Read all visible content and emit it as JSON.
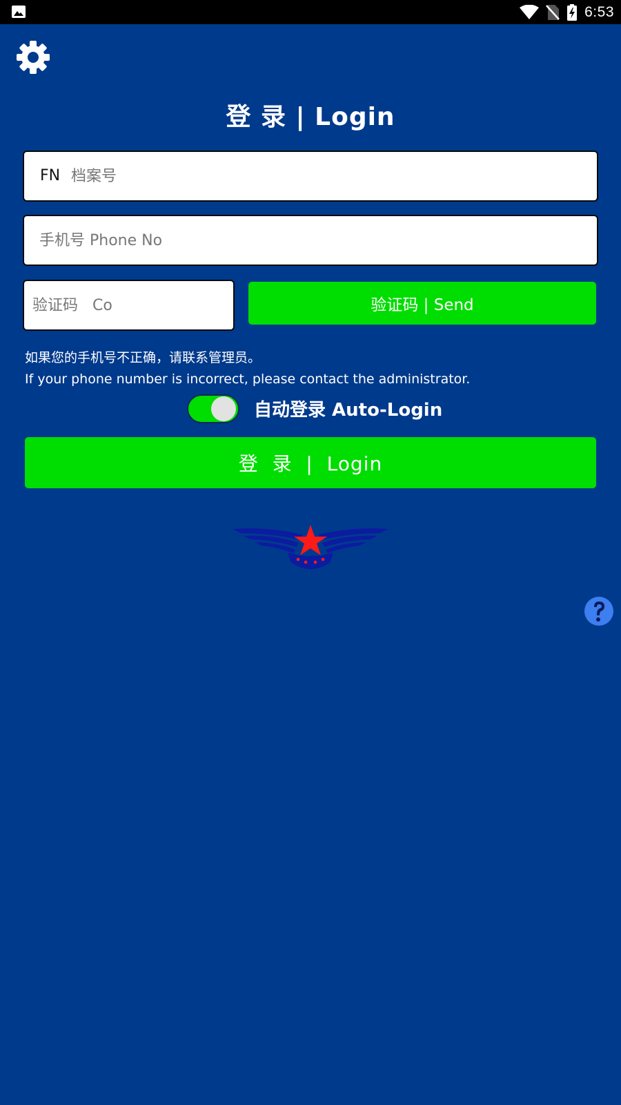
{
  "status_bar": {
    "time": "6:53",
    "icons": [
      "gallery-icon",
      "wifi-icon",
      "no-sim-icon",
      "battery-charging-icon"
    ]
  },
  "header": {
    "settings_icon": "gear-icon",
    "title": "登 录 | Login"
  },
  "form": {
    "fn_prefix": "FN",
    "fn_placeholder": "档案号",
    "phone_placeholder": "手机号 Phone No",
    "code_placeholder": "验证码   Co",
    "send_label": "验证码 | Send"
  },
  "notice": {
    "line_zh": "如果您的手机号不正确，请联系管理员。",
    "line_en": "If your phone number is incorrect, please contact the administrator."
  },
  "auto_login": {
    "label": "自动登录 Auto-Login",
    "enabled": true
  },
  "login_button": {
    "label": "登  录  |  Login"
  },
  "logo": {
    "icon": "winged-star-logo"
  },
  "help": {
    "icon": "question-icon"
  },
  "colors": {
    "background": "#003a8c",
    "accent_green": "#00dd00",
    "help_blue": "#3d7ef0",
    "logo_red": "#ff1a1a",
    "logo_navy": "#0b1ca0"
  }
}
